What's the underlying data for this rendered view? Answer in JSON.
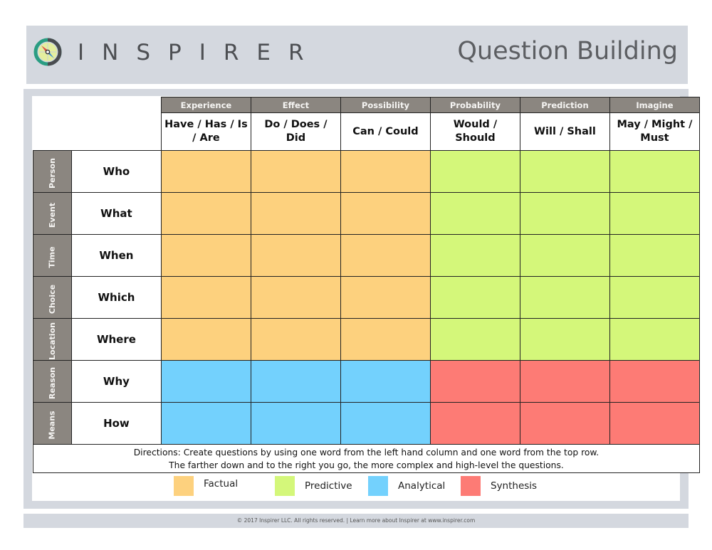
{
  "header": {
    "brand": "INSPIRER",
    "logo_icon": "compass-icon",
    "title": "Question Building"
  },
  "columns": [
    {
      "category": "Experience",
      "verbs": "Have / Has / Is / Are"
    },
    {
      "category": "Effect",
      "verbs": "Do / Does / Did"
    },
    {
      "category": "Possibility",
      "verbs": "Can / Could"
    },
    {
      "category": "Probability",
      "verbs": "Would / Should"
    },
    {
      "category": "Prediction",
      "verbs": "Will / Shall"
    },
    {
      "category": "Imagine",
      "verbs": "May / Might / Must"
    }
  ],
  "rows": [
    {
      "category": "Person",
      "word": "Who",
      "cells": [
        "factual",
        "factual",
        "factual",
        "predictive",
        "predictive",
        "predictive"
      ]
    },
    {
      "category": "Event",
      "word": "What",
      "cells": [
        "factual",
        "factual",
        "factual",
        "predictive",
        "predictive",
        "predictive"
      ]
    },
    {
      "category": "Time",
      "word": "When",
      "cells": [
        "factual",
        "factual",
        "factual",
        "predictive",
        "predictive",
        "predictive"
      ]
    },
    {
      "category": "Choice",
      "word": "Which",
      "cells": [
        "factual",
        "factual",
        "factual",
        "predictive",
        "predictive",
        "predictive"
      ]
    },
    {
      "category": "Location",
      "word": "Where",
      "cells": [
        "factual",
        "factual",
        "factual",
        "predictive",
        "predictive",
        "predictive"
      ]
    },
    {
      "category": "Reason",
      "word": "Why",
      "cells": [
        "analytical",
        "analytical",
        "analytical",
        "synthesis",
        "synthesis",
        "synthesis"
      ]
    },
    {
      "category": "Means",
      "word": "How",
      "cells": [
        "analytical",
        "analytical",
        "analytical",
        "synthesis",
        "synthesis",
        "synthesis"
      ]
    }
  ],
  "directions": {
    "line1": "Directions: Create questions by using one word from the left hand column and one word from the top row.",
    "line2": "The farther down and to the right you go, the more complex and high-level the questions."
  },
  "legend": [
    {
      "key": "factual",
      "label": "Factual",
      "color": "#fdd17e"
    },
    {
      "key": "predictive",
      "label": "Predictive",
      "color": "#d4f77a"
    },
    {
      "key": "analytical",
      "label": "Analytical",
      "color": "#73d1fd"
    },
    {
      "key": "synthesis",
      "label": "Synthesis",
      "color": "#fd7b75"
    }
  ],
  "colors": {
    "header_band": "#d4d8df",
    "category_header": "#8b8680",
    "brand_text": "#4d4f53"
  },
  "footer": {
    "text": "© 2017 Inspirer LLC. All rights reserved.  |  Learn more about Inspirer at www.inspirer.com"
  }
}
